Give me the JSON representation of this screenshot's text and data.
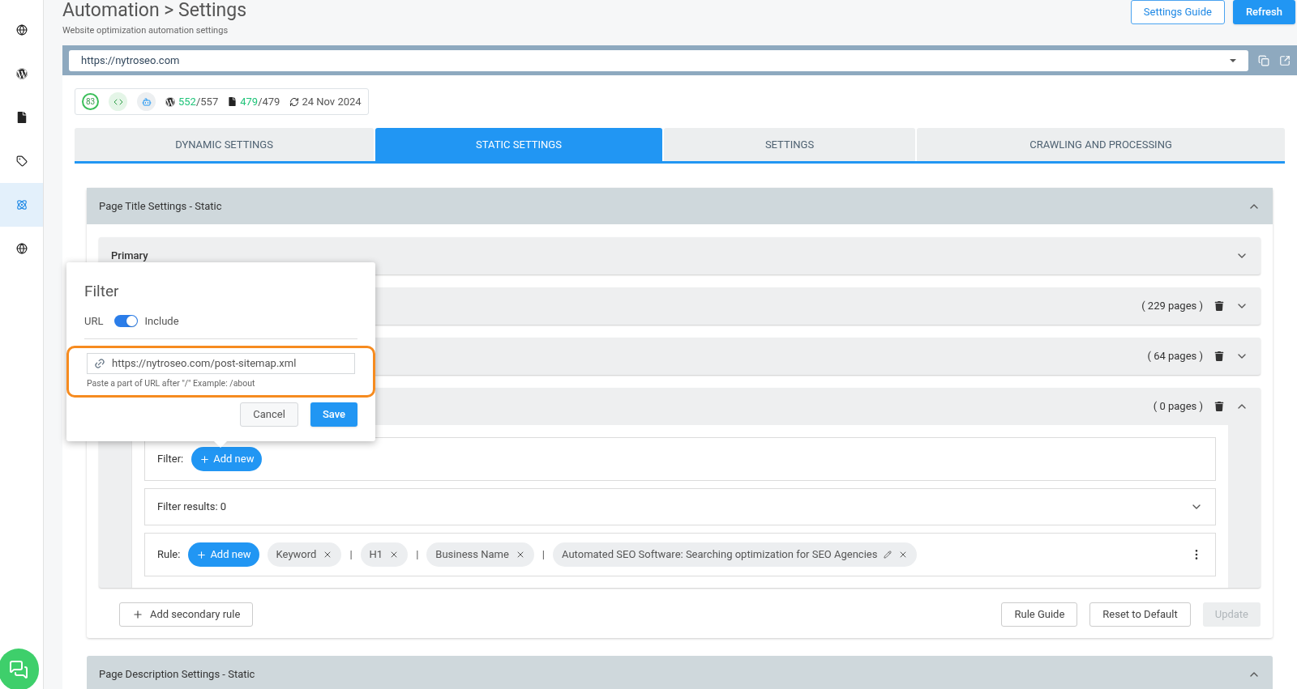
{
  "sidebar": {
    "items": [
      {
        "selected": false
      },
      {
        "selected": false
      },
      {
        "selected": false
      },
      {
        "selected": false
      },
      {
        "selected": true
      },
      {
        "selected": false
      }
    ]
  },
  "header": {
    "title": "Automation > Settings",
    "subtitle": "Website optimization automation settings",
    "guide_button": "Settings Guide",
    "refresh_button": "Refresh"
  },
  "site_select": {
    "value": "https://nytroseo.com"
  },
  "stats": {
    "score": "83",
    "wp_done": "552",
    "wp_total": "/557",
    "pages_done": "479",
    "pages_total": "/479",
    "date": "24 Nov 2024"
  },
  "tabs": [
    {
      "label": "DYNAMIC SETTINGS",
      "selected": false
    },
    {
      "label": "STATIC SETTINGS",
      "selected": true
    },
    {
      "label": "SETTINGS",
      "selected": false
    },
    {
      "label": "CRAWLING AND PROCESSING",
      "selected": false
    }
  ],
  "section": {
    "title": "Page Title Settings - Static",
    "expanded": true
  },
  "primary": {
    "title": "Primary",
    "expanded": false
  },
  "rule_groups": [
    {
      "count": "( 229 pages )",
      "expanded": false
    },
    {
      "count": "( 64 pages )",
      "expanded": false
    },
    {
      "count": "( 0 pages )",
      "expanded": true
    }
  ],
  "rule_detail": {
    "filter_label": "Filter:",
    "filter_add": "Add new",
    "filter_results": "Filter results: 0",
    "results_expanded": false,
    "rule_label": "Rule:",
    "rule_add": "Add new",
    "items": [
      {
        "kind": "chip",
        "text": "Keyword",
        "editable": false
      },
      {
        "kind": "separator",
        "text": "|"
      },
      {
        "kind": "chip",
        "text": "H1",
        "editable": false
      },
      {
        "kind": "separator",
        "text": "|"
      },
      {
        "kind": "chip",
        "text": "Business Name",
        "editable": false
      },
      {
        "kind": "separator",
        "text": "|"
      },
      {
        "kind": "chip",
        "text": "Automated SEO Software: Searching optimization for SEO Agencies",
        "editable": true
      }
    ]
  },
  "section_footer": {
    "add_secondary": "Add secondary rule",
    "rule_guide": "Rule Guide",
    "reset": "Reset to Default",
    "update": "Update",
    "update_disabled": true
  },
  "section2": {
    "title": "Page Description Settings - Static",
    "expanded": true
  },
  "popover": {
    "title": "Filter",
    "url_label": "URL",
    "toggle_on": true,
    "include_label": "Include",
    "input_value": "https://nytroseo.com/post-sitemap.xml",
    "hint": "Paste a part of URL after \"/\" Example: /about",
    "highlighted": true,
    "cancel": "Cancel",
    "save": "Save"
  }
}
